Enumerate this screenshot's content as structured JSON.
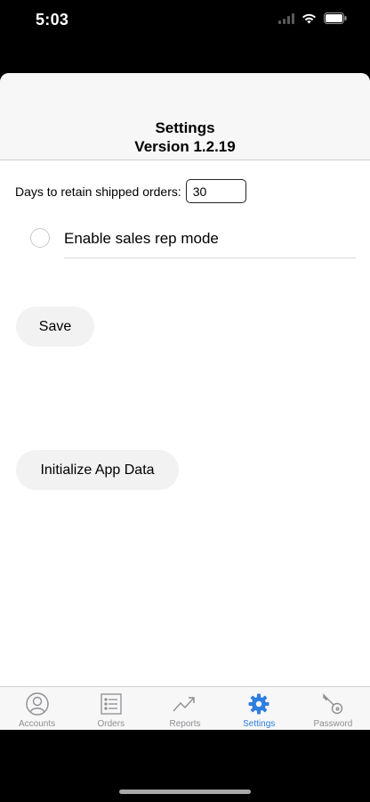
{
  "status_bar": {
    "time": "5:03"
  },
  "header": {
    "title": "Settings",
    "version": "Version 1.2.19"
  },
  "settings": {
    "retain_label": "Days to retain shipped orders:",
    "retain_value": "30",
    "sales_rep_label": "Enable sales rep mode",
    "sales_rep_enabled": false
  },
  "buttons": {
    "save_label": "Save",
    "init_label": "Initialize App Data"
  },
  "tab_bar": {
    "active_color": "#2f7de1",
    "inactive_color": "#8e8e93",
    "tabs": [
      {
        "label": "Accounts",
        "icon": "person-circle-icon"
      },
      {
        "label": "Orders",
        "icon": "list-icon"
      },
      {
        "label": "Reports",
        "icon": "trend-chart-icon"
      },
      {
        "label": "Settings",
        "icon": "gear-icon",
        "active": true
      },
      {
        "label": "Password",
        "icon": "key-icon"
      }
    ]
  }
}
